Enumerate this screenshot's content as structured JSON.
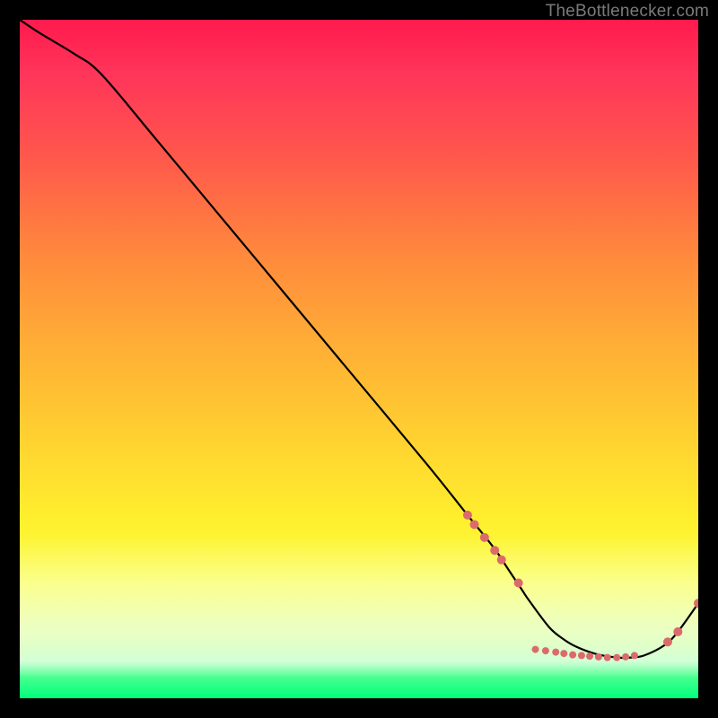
{
  "watermark": "TheBottlenecker.com",
  "chart_data": {
    "type": "line",
    "title": "",
    "xlabel": "",
    "ylabel": "",
    "xlim": [
      0,
      100
    ],
    "ylim": [
      0,
      100
    ],
    "series": [
      {
        "name": "curve",
        "x": [
          0,
          3,
          8,
          12,
          20,
          30,
          40,
          50,
          60,
          66,
          70,
          72,
          74,
          75,
          78,
          80,
          82,
          85,
          88,
          90,
          92,
          95,
          97,
          100
        ],
        "y": [
          100,
          98,
          95,
          92,
          82.5,
          70.5,
          58.5,
          46.5,
          34.5,
          27,
          22,
          19,
          16,
          14.5,
          10.5,
          8.8,
          7.6,
          6.5,
          6.0,
          6.0,
          6.3,
          7.8,
          9.8,
          14
        ]
      }
    ],
    "markers": {
      "name": "highlight-points",
      "color": "#db6b6b",
      "points": [
        {
          "x": 66.0,
          "y": 27.0,
          "r": 5
        },
        {
          "x": 67.0,
          "y": 25.6,
          "r": 5
        },
        {
          "x": 68.5,
          "y": 23.7,
          "r": 5
        },
        {
          "x": 70.0,
          "y": 21.8,
          "r": 5
        },
        {
          "x": 71.0,
          "y": 20.4,
          "r": 5
        },
        {
          "x": 73.5,
          "y": 17.0,
          "r": 5
        },
        {
          "x": 76.0,
          "y": 7.2,
          "r": 4
        },
        {
          "x": 77.5,
          "y": 7.0,
          "r": 4
        },
        {
          "x": 79.0,
          "y": 6.8,
          "r": 4
        },
        {
          "x": 80.2,
          "y": 6.6,
          "r": 4
        },
        {
          "x": 81.5,
          "y": 6.4,
          "r": 4
        },
        {
          "x": 82.8,
          "y": 6.3,
          "r": 4
        },
        {
          "x": 84.0,
          "y": 6.2,
          "r": 4
        },
        {
          "x": 85.3,
          "y": 6.1,
          "r": 4
        },
        {
          "x": 86.6,
          "y": 6.0,
          "r": 4
        },
        {
          "x": 88.0,
          "y": 6.0,
          "r": 4
        },
        {
          "x": 89.3,
          "y": 6.1,
          "r": 4
        },
        {
          "x": 90.6,
          "y": 6.3,
          "r": 4
        },
        {
          "x": 95.5,
          "y": 8.3,
          "r": 5
        },
        {
          "x": 97.0,
          "y": 9.8,
          "r": 5
        },
        {
          "x": 100.0,
          "y": 14.0,
          "r": 5
        }
      ]
    },
    "background": {
      "type": "vertical-gradient",
      "stops": [
        {
          "pos": 0.0,
          "color": "#ff1a4d"
        },
        {
          "pos": 0.35,
          "color": "#ff8a3c"
        },
        {
          "pos": 0.7,
          "color": "#fff02e"
        },
        {
          "pos": 0.92,
          "color": "#d6ffd9"
        },
        {
          "pos": 1.0,
          "color": "#00ff7b"
        }
      ]
    }
  }
}
